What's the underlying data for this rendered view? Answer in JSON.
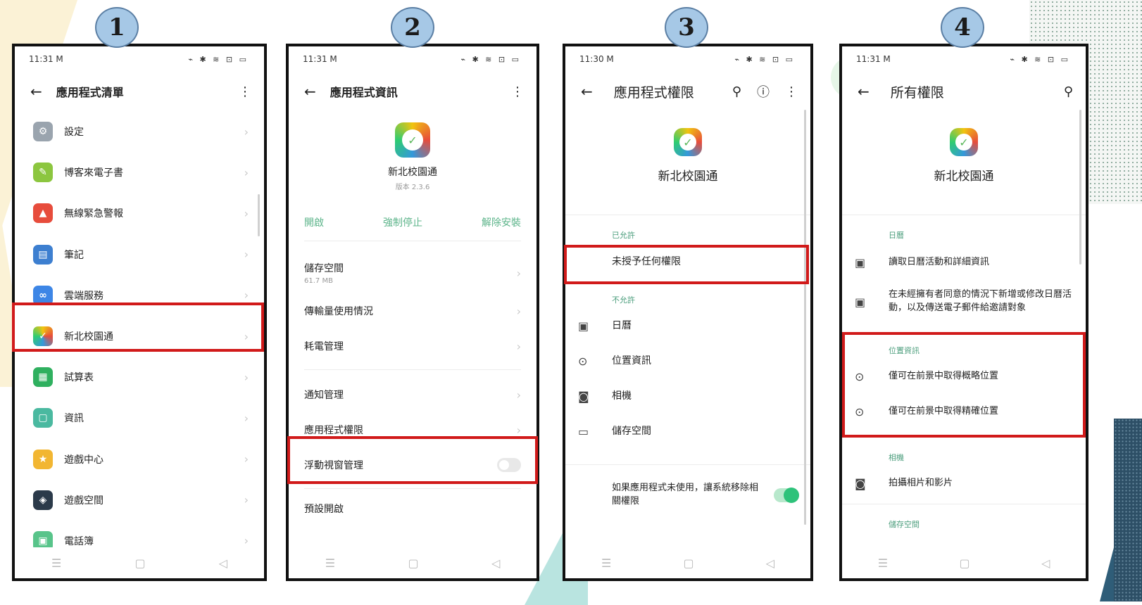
{
  "steps": [
    "1",
    "2",
    "3",
    "4"
  ],
  "common": {
    "time1": "11:31",
    "time3": "11:30",
    "status_left_icons": "M",
    "status_right_icons": "⌁ ✱ ≋ ⊡ ▭"
  },
  "phone1": {
    "title": "應用程式清單",
    "apps": [
      {
        "label": "設定",
        "color": "#9aa4ae",
        "glyph": "⚙"
      },
      {
        "label": "博客來電子書",
        "color": "#8cc63f",
        "glyph": "✎"
      },
      {
        "label": "無線緊急警報",
        "color": "#e74c3c",
        "glyph": "▲"
      },
      {
        "label": "筆記",
        "color": "#3d7fd0",
        "glyph": "▤"
      },
      {
        "label": "雲端服務",
        "color": "#3d86e6",
        "glyph": "∞"
      },
      {
        "label": "新北校園通",
        "color": "#ffffff",
        "glyph": "●"
      },
      {
        "label": "試算表",
        "color": "#2fb05f",
        "glyph": "▦"
      },
      {
        "label": "資訊",
        "color": "#4ab9a0",
        "glyph": "▢"
      },
      {
        "label": "遊戲中心",
        "color": "#f2b632",
        "glyph": "★"
      },
      {
        "label": "遊戲空間",
        "color": "#2b3a4a",
        "glyph": "◈"
      },
      {
        "label": "電話簿",
        "color": "#58c48a",
        "glyph": "▣"
      }
    ]
  },
  "phone2": {
    "title": "應用程式資訊",
    "app_name": "新北校園通",
    "version": "版本 2.3.6",
    "actions": {
      "open": "開啟",
      "force_stop": "強制停止",
      "uninstall": "解除安裝"
    },
    "storage": "儲存空間",
    "storage_size": "61.7 MB",
    "data_usage": "傳輸量使用情況",
    "battery": "耗電管理",
    "notifications": "通知管理",
    "permissions": "應用程式權限",
    "floating": "浮動視窗管理",
    "cutoff": "預設開啟"
  },
  "phone3": {
    "title": "應用程式權限",
    "app_name": "新北校園通",
    "allowed": "已允許",
    "none_granted": "未授予任何權限",
    "not_allowed": "不允許",
    "perms": [
      "日曆",
      "位置資訊",
      "相機",
      "儲存空間"
    ],
    "auto_remove": "如果應用程式未使用，讓系統移除相關權限"
  },
  "phone4": {
    "title": "所有權限",
    "app_name": "新北校園通",
    "calendar_section": "日曆",
    "calendar_read": "讀取日曆活動和詳細資訊",
    "calendar_write": "在未經擁有者同意的情況下新增或修改日曆活動，以及傳送電子郵件給邀請對象",
    "location_section": "位置資訊",
    "loc_coarse": "僅可在前景中取得概略位置",
    "loc_fine": "僅可在前景中取得精確位置",
    "camera_section": "相機",
    "camera_take": "拍攝相片和影片",
    "storage_section": "儲存空間"
  }
}
